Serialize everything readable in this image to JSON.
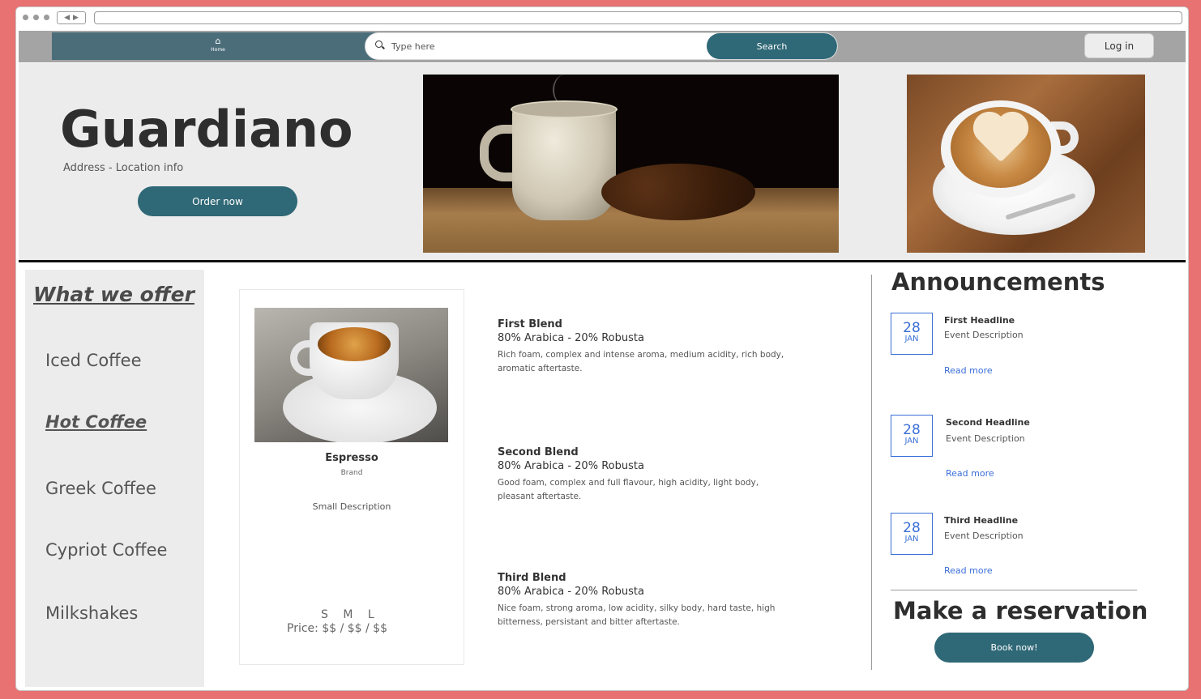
{
  "nav": {
    "home_label": "Home",
    "search_placeholder": "Type here",
    "search_button": "Search",
    "login_button": "Log in"
  },
  "hero": {
    "brand": "Guardiano",
    "address": "Address - Location info",
    "order_button": "Order now"
  },
  "sidebar": {
    "title": "What we offer",
    "items": [
      {
        "label": "Iced Coffee",
        "active": false
      },
      {
        "label": "Hot Coffee",
        "active": true
      },
      {
        "label": "Greek Coffee",
        "active": false
      },
      {
        "label": "Cypriot Coffee",
        "active": false
      },
      {
        "label": "Milkshakes",
        "active": false
      }
    ]
  },
  "product": {
    "name": "Espresso",
    "brand": "Brand",
    "description": "Small Description",
    "sizes": "S M L",
    "price": "Price: $$ / $$ / $$"
  },
  "blends": [
    {
      "title": "First Blend",
      "subtitle": "80% Arabica - 20% Robusta",
      "description": "Rich foam, complex and intense aroma, medium acidity, rich body, aromatic aftertaste."
    },
    {
      "title": "Second Blend",
      "subtitle": "80% Arabica - 20% Robusta",
      "description": "Good foam, complex and full flavour, high acidity, light body, pleasant aftertaste."
    },
    {
      "title": "Third Blend",
      "subtitle": "80% Arabica - 20% Robusta",
      "description": "Nice foam, strong aroma, low acidity, silky body, hard taste, high bitterness, persistant and bitter aftertaste."
    }
  ],
  "announcements": {
    "title": "Announcements",
    "items": [
      {
        "day": "28",
        "month": "JAN",
        "headline": "First Headline",
        "description": "Event Description",
        "link": "Read more"
      },
      {
        "day": "28",
        "month": "JAN",
        "headline": "Second Headline",
        "description": "Event Description",
        "link": "Read more"
      },
      {
        "day": "28",
        "month": "JAN",
        "headline": "Third Headline",
        "description": "Event Description",
        "link": "Read more"
      }
    ]
  },
  "reservation": {
    "title": "Make a reservation",
    "button": "Book now!"
  },
  "icons": {
    "home": "home-icon",
    "search": "search-icon",
    "browser_nav": "arrows-icon"
  },
  "colors": {
    "frame": "#e87171",
    "accent": "#2f6876",
    "link": "#3a6fd8",
    "panel": "#ececec"
  }
}
